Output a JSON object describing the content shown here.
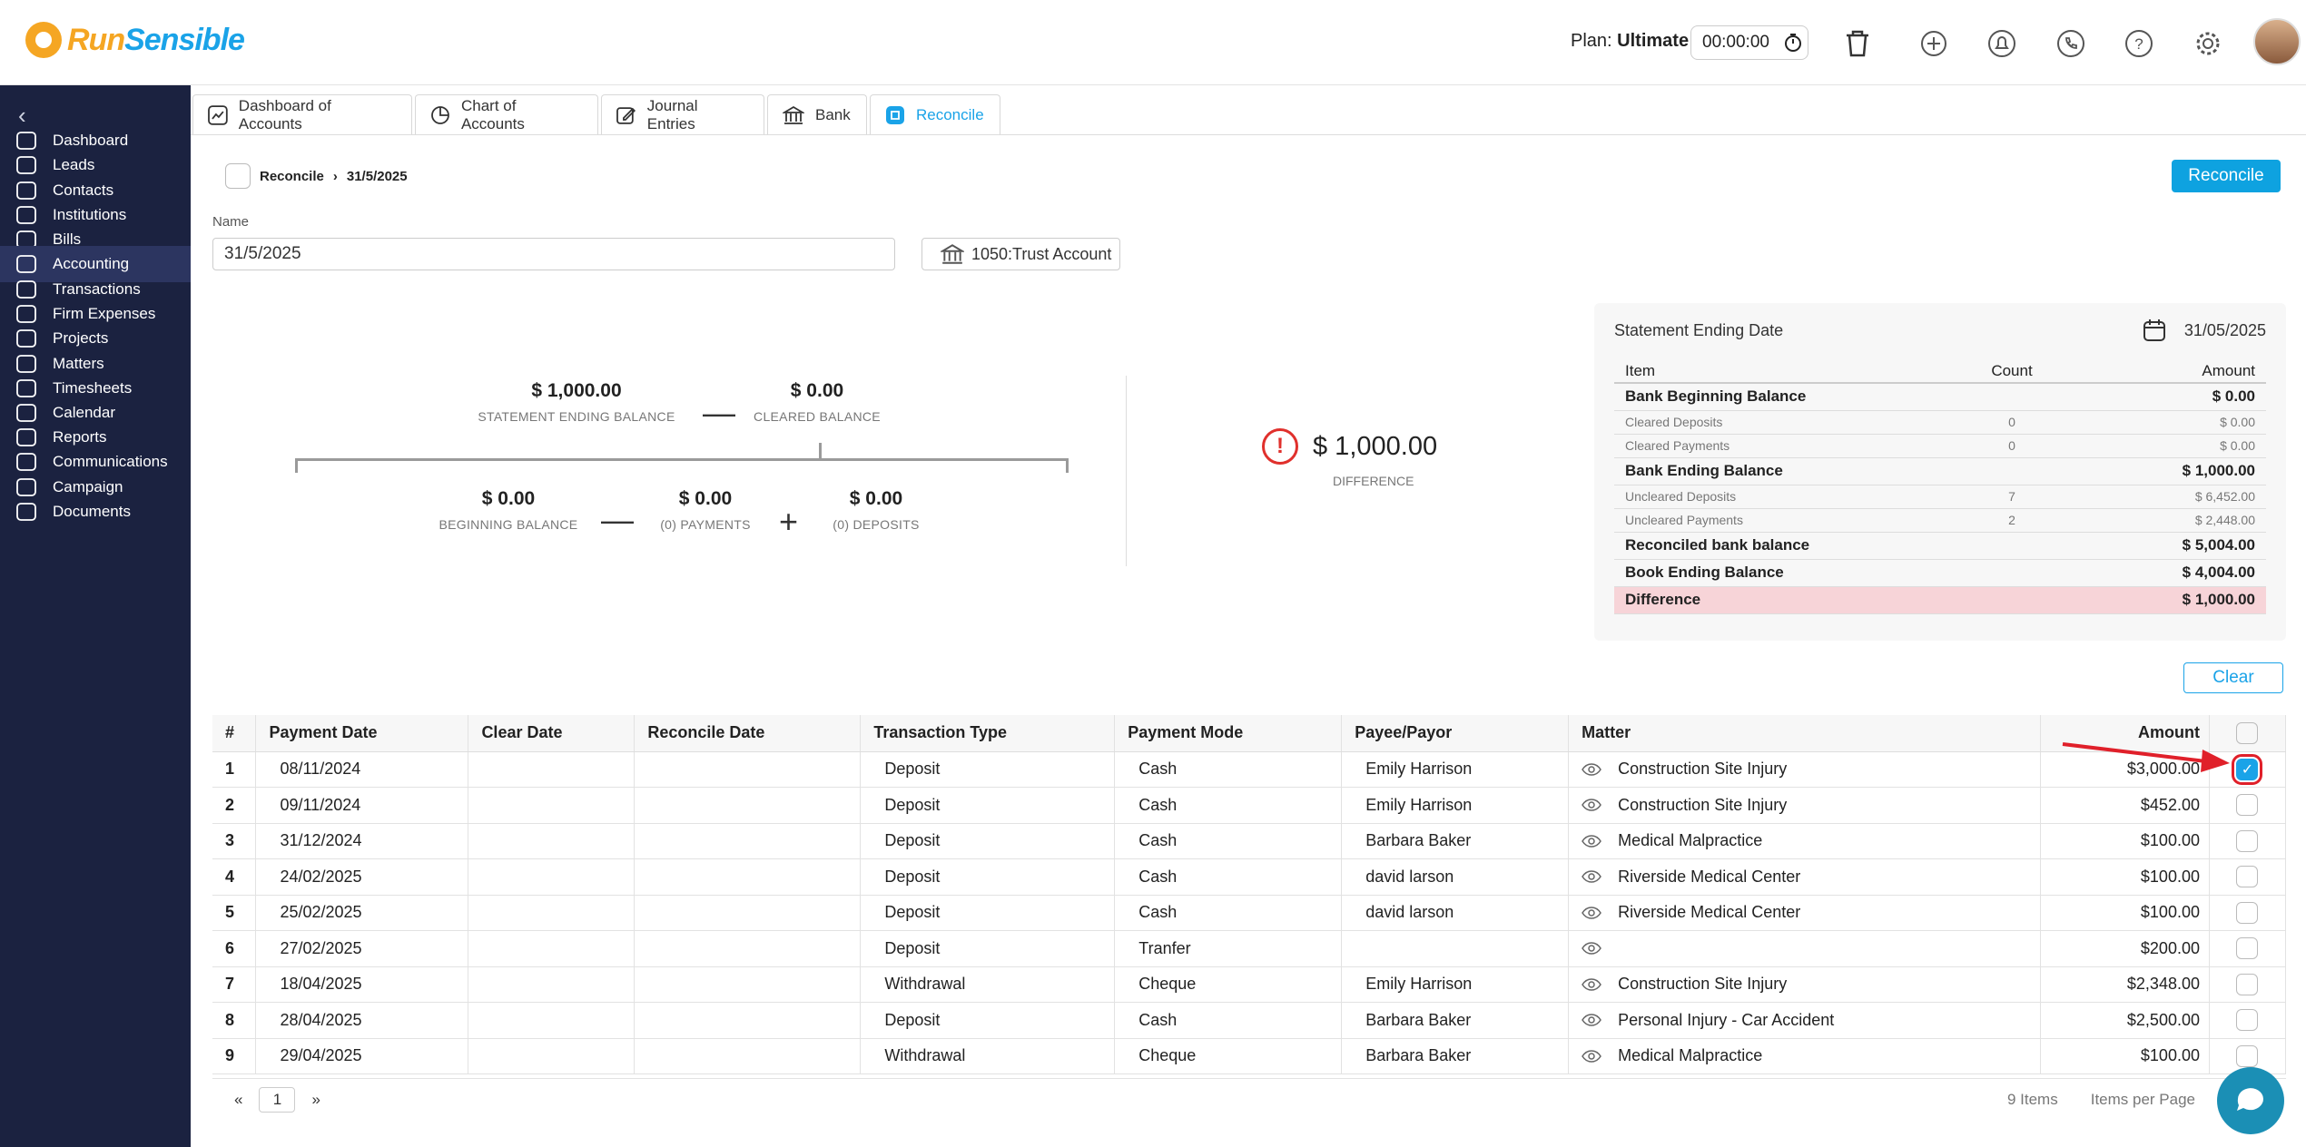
{
  "brand": {
    "name_part1": "Run",
    "name_part2": "Sensible"
  },
  "header": {
    "plan_prefix": "Plan:",
    "plan_value": "Ultimate",
    "timer": "00:00:00",
    "icons": [
      "stopwatch-icon",
      "trash-icon",
      "add-icon",
      "bell-icon",
      "phone-icon",
      "help-icon",
      "settings-icon"
    ]
  },
  "sidebar": {
    "items": [
      {
        "label": "Dashboard",
        "icon": "grid-icon"
      },
      {
        "label": "Leads",
        "icon": "star-icon"
      },
      {
        "label": "Contacts",
        "icon": "user-icon"
      },
      {
        "label": "Institutions",
        "icon": "building-icon"
      },
      {
        "label": "Bills",
        "icon": "bill-icon"
      },
      {
        "label": "Accounting",
        "icon": "accounting-icon",
        "active": true
      },
      {
        "label": "Transactions",
        "icon": "transactions-icon"
      },
      {
        "label": "Firm Expenses",
        "icon": "expenses-icon"
      },
      {
        "label": "Projects",
        "icon": "list-icon"
      },
      {
        "label": "Matters",
        "icon": "briefcase-icon"
      },
      {
        "label": "Timesheets",
        "icon": "clock-icon"
      },
      {
        "label": "Calendar",
        "icon": "calendar-icon"
      },
      {
        "label": "Reports",
        "icon": "reports-icon"
      },
      {
        "label": "Communications",
        "icon": "chat-icon"
      },
      {
        "label": "Campaign",
        "icon": "mail-icon"
      },
      {
        "label": "Documents",
        "icon": "folder-icon"
      }
    ]
  },
  "tabs": [
    {
      "label": "Dashboard of Accounts",
      "icon": "chart-icon"
    },
    {
      "label": "Chart of Accounts",
      "icon": "pie-icon"
    },
    {
      "label": "Journal Entries",
      "icon": "edit-icon"
    },
    {
      "label": "Bank",
      "icon": "bank-icon"
    },
    {
      "label": "Reconcile",
      "icon": "reconcile-icon",
      "active": true
    }
  ],
  "breadcrumb": {
    "root": "Reconcile",
    "current": "31/5/2025"
  },
  "actions": {
    "reconcile": "Reconcile",
    "clear": "Clear"
  },
  "form": {
    "name_label": "Name",
    "name_value": "31/5/2025",
    "account": "1050:Trust Account"
  },
  "balances": {
    "statement_ending": {
      "value": "$ 1,000.00",
      "label": "STATEMENT ENDING BALANCE"
    },
    "cleared": {
      "value": "$ 0.00",
      "label": "CLEARED BALANCE"
    },
    "beginning": {
      "value": "$ 0.00",
      "label": "BEGINNING BALANCE"
    },
    "payments": {
      "value": "$ 0.00",
      "label": "(0) PAYMENTS"
    },
    "deposits": {
      "value": "$ 0.00",
      "label": "(0) DEPOSITS"
    },
    "difference": {
      "value": "$ 1,000.00",
      "label": "DIFFERENCE"
    }
  },
  "summary": {
    "title": "Statement Ending Date",
    "date": "31/05/2025",
    "headers": [
      "Item",
      "Count",
      "Amount"
    ],
    "rows": [
      {
        "item": "Bank Beginning Balance",
        "count": "",
        "amount": "$ 0.00",
        "style": "bold"
      },
      {
        "item": "Cleared Deposits",
        "count": "0",
        "amount": "$ 0.00",
        "style": "sub"
      },
      {
        "item": "Cleared Payments",
        "count": "0",
        "amount": "$ 0.00",
        "style": "sub"
      },
      {
        "item": "Bank Ending Balance",
        "count": "",
        "amount": "$ 1,000.00",
        "style": "bold"
      },
      {
        "item": "Uncleared Deposits",
        "count": "7",
        "amount": "$ 6,452.00",
        "style": "sub"
      },
      {
        "item": "Uncleared Payments",
        "count": "2",
        "amount": "$ 2,448.00",
        "style": "sub"
      },
      {
        "item": "Reconciled bank balance",
        "count": "",
        "amount": "$ 5,004.00",
        "style": "bold"
      },
      {
        "item": "Book Ending Balance",
        "count": "",
        "amount": "$ 4,004.00",
        "style": "bold"
      },
      {
        "item": "Difference",
        "count": "",
        "amount": "$ 1,000.00",
        "style": "red"
      }
    ]
  },
  "table": {
    "headers": [
      "#",
      "Payment Date",
      "Clear Date",
      "Reconcile Date",
      "Transaction Type",
      "Payment Mode",
      "Payee/Payor",
      "Matter",
      "Amount"
    ],
    "rows": [
      {
        "n": "1",
        "date": "08/11/2024",
        "type": "Deposit",
        "mode": "Cash",
        "payee": "Emily Harrison",
        "matter": "Construction Site Injury",
        "amount": "$3,000.00",
        "checked": true
      },
      {
        "n": "2",
        "date": "09/11/2024",
        "type": "Deposit",
        "mode": "Cash",
        "payee": "Emily Harrison",
        "matter": "Construction Site Injury",
        "amount": "$452.00",
        "checked": false
      },
      {
        "n": "3",
        "date": "31/12/2024",
        "type": "Deposit",
        "mode": "Cash",
        "payee": "Barbara Baker",
        "matter": "Medical Malpractice",
        "amount": "$100.00",
        "checked": false
      },
      {
        "n": "4",
        "date": "24/02/2025",
        "type": "Deposit",
        "mode": "Cash",
        "payee": "david larson",
        "matter": "Riverside Medical Center",
        "amount": "$100.00",
        "checked": false
      },
      {
        "n": "5",
        "date": "25/02/2025",
        "type": "Deposit",
        "mode": "Cash",
        "payee": "david larson",
        "matter": "Riverside Medical Center",
        "amount": "$100.00",
        "checked": false
      },
      {
        "n": "6",
        "date": "27/02/2025",
        "type": "Deposit",
        "mode": "Tranfer",
        "payee": "",
        "matter": "",
        "amount": "$200.00",
        "checked": false
      },
      {
        "n": "7",
        "date": "18/04/2025",
        "type": "Withdrawal",
        "mode": "Cheque",
        "payee": "Emily Harrison",
        "matter": "Construction Site Injury",
        "amount": "$2,348.00",
        "checked": false
      },
      {
        "n": "8",
        "date": "28/04/2025",
        "type": "Deposit",
        "mode": "Cash",
        "payee": "Barbara Baker",
        "matter": "Personal Injury - Car Accident",
        "amount": "$2,500.00",
        "checked": false
      },
      {
        "n": "9",
        "date": "29/04/2025",
        "type": "Withdrawal",
        "mode": "Cheque",
        "payee": "Barbara Baker",
        "matter": "Medical Malpractice",
        "amount": "$100.00",
        "checked": false
      }
    ]
  },
  "pagination": {
    "prev": "«",
    "page": "1",
    "next": "»",
    "items": "9 Items",
    "per_page": "Items per Page"
  },
  "colors": {
    "accent": "#1aa3e8",
    "sidebar": "#1b2240",
    "highlight": "#e0202a",
    "brand_orange": "#f5a623"
  }
}
